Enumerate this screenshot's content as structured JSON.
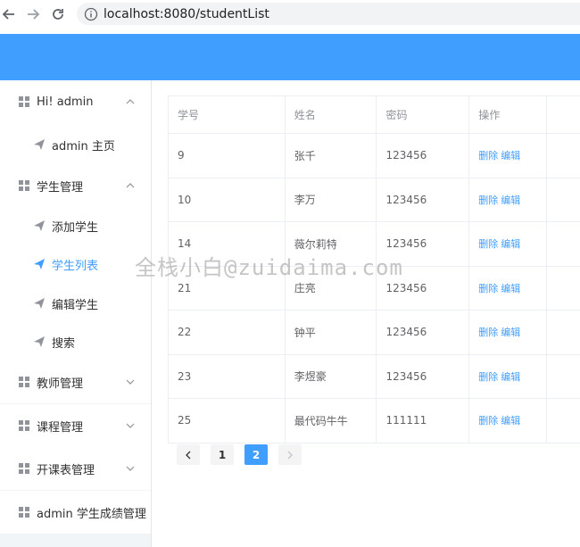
{
  "browser": {
    "url": "localhost:8080/studentList"
  },
  "sidebar": {
    "items": [
      {
        "label": "Hi! admin",
        "type": "group",
        "expanded": true
      },
      {
        "label": "admin 主页",
        "type": "sub"
      },
      {
        "label": "学生管理",
        "type": "group",
        "expanded": true
      },
      {
        "label": "添加学生",
        "type": "sub"
      },
      {
        "label": "学生列表",
        "type": "sub",
        "active": true
      },
      {
        "label": "编辑学生",
        "type": "sub"
      },
      {
        "label": "搜索",
        "type": "sub"
      },
      {
        "label": "教师管理",
        "type": "group",
        "expanded": false
      },
      {
        "label": "课程管理",
        "type": "group",
        "expanded": false
      },
      {
        "label": "开课表管理",
        "type": "group",
        "expanded": false
      },
      {
        "label": "admin 学生成绩管理",
        "type": "group"
      }
    ]
  },
  "table": {
    "headers": [
      "学号",
      "姓名",
      "密码",
      "操作"
    ],
    "rows": [
      {
        "id": "9",
        "name": "张千",
        "password": "123456"
      },
      {
        "id": "10",
        "name": "李万",
        "password": "123456"
      },
      {
        "id": "14",
        "name": "薇尔莉特",
        "password": "123456"
      },
      {
        "id": "21",
        "name": "庄亮",
        "password": "123456"
      },
      {
        "id": "22",
        "name": "钟平",
        "password": "123456"
      },
      {
        "id": "23",
        "name": "李煜豪",
        "password": "123456"
      },
      {
        "id": "25",
        "name": "最代码牛牛",
        "password": "111111"
      }
    ],
    "delete_label": "删除",
    "edit_label": "编辑"
  },
  "pagination": {
    "pages": [
      "1",
      "2"
    ],
    "current": "2"
  },
  "watermark": "全栈小白@zuidaima.com",
  "colors": {
    "primary": "#409eff",
    "header": "#409eff",
    "sidebar_bg": "#f2f5f8"
  }
}
